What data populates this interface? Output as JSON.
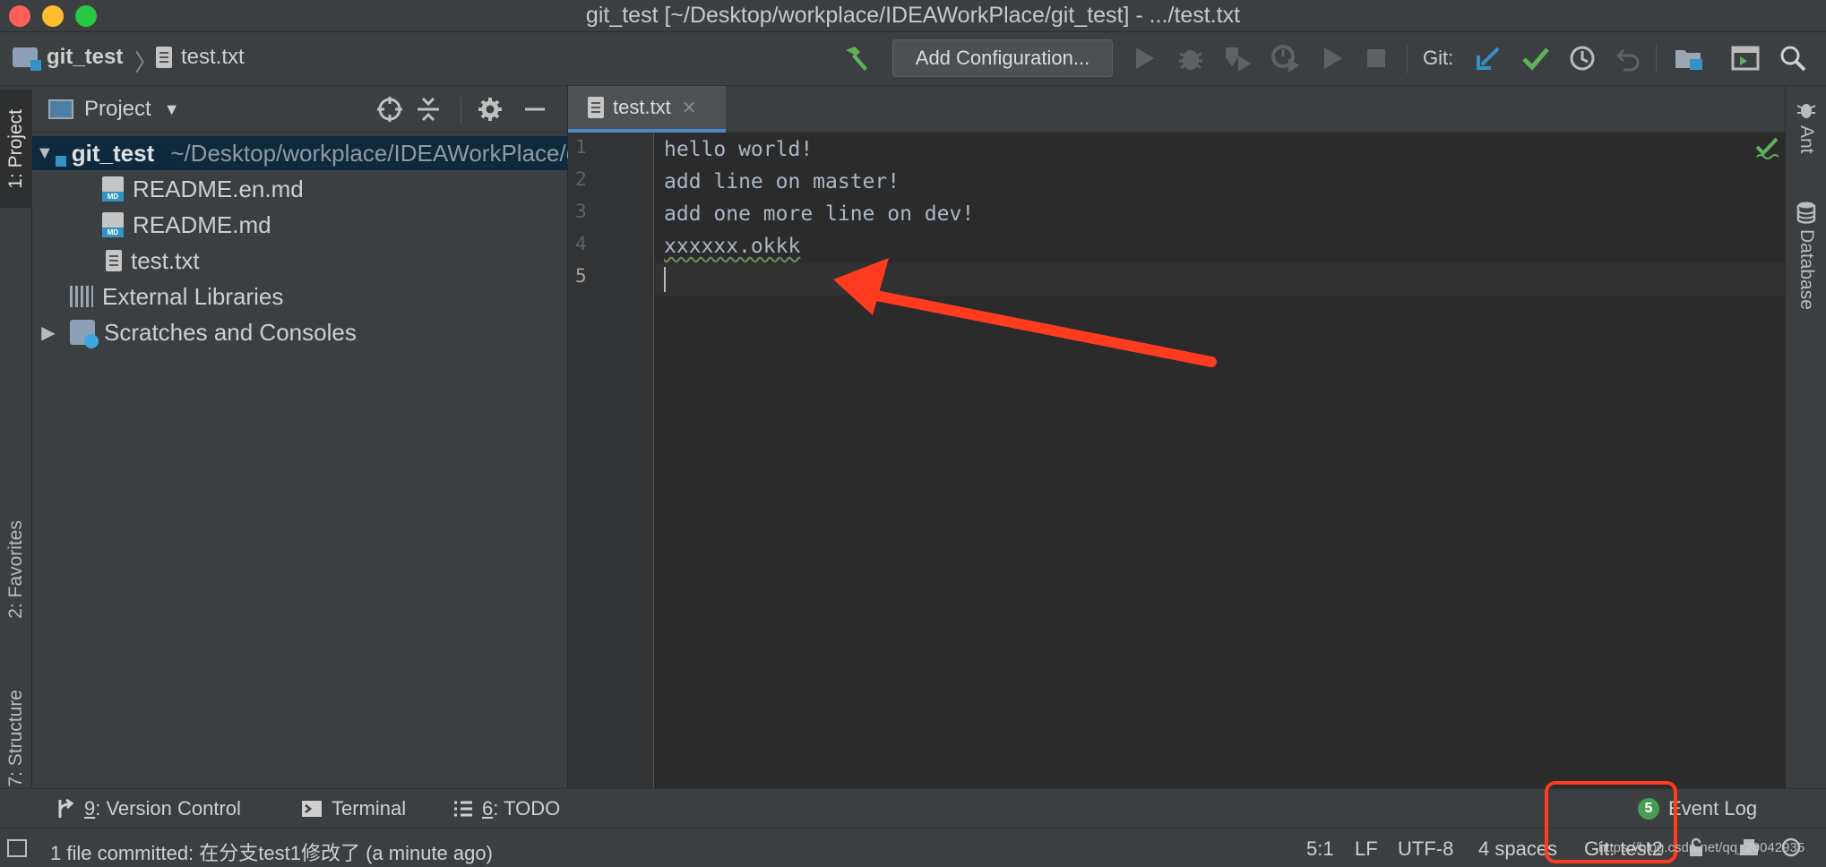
{
  "window": {
    "title": "git_test [~/Desktop/workplace/IDEAWorkPlace/git_test] - .../test.txt"
  },
  "navbar": {
    "project_crumb": "git_test",
    "file_crumb": "test.txt",
    "separator": "〉",
    "add_configuration_label": "Add Configuration...",
    "git_label": "Git:",
    "icons": [
      "hammer-icon",
      "run-icon",
      "debug-icon",
      "coverage-icon",
      "profile-icon",
      "run-anything-icon",
      "stop-icon",
      "git-update-icon",
      "git-commit-icon",
      "git-history-icon",
      "git-rollback-icon",
      "project-structure-icon",
      "terminal-run-icon",
      "search-icon"
    ]
  },
  "left_tabs": {
    "project": "1: Project",
    "favorites": "2: Favorites",
    "structure": "7: Structure"
  },
  "right_tabs": {
    "ant": "Ant",
    "database": "Database"
  },
  "project_panel": {
    "title": "Project",
    "root": {
      "name": "git_test",
      "path": "~/Desktop/workplace/IDEAWorkPlace/git_test"
    },
    "files": [
      {
        "name": "README.en.md",
        "kind": "markdown"
      },
      {
        "name": "README.md",
        "kind": "markdown"
      },
      {
        "name": "test.txt",
        "kind": "text"
      }
    ],
    "external_libraries": "External Libraries",
    "scratches": "Scratches and Consoles"
  },
  "editor": {
    "tab_label": "test.txt",
    "tab_close": "✕",
    "lines": [
      "hello world!",
      "add line on master!",
      "add one more line on dev!",
      "xxxxxx.okkk",
      ""
    ],
    "line_numbers": [
      "1",
      "2",
      "3",
      "4",
      "5"
    ],
    "current_line": 5
  },
  "tool_window_bar": {
    "version_control": {
      "num": "9",
      "label": ": Version Control"
    },
    "terminal": "Terminal",
    "todo": {
      "num": "6",
      "label": ": TODO"
    },
    "event_log_count": "5",
    "event_log": "Event Log"
  },
  "status_bar": {
    "message": "1 file committed: 在分支test1修改了 (a minute ago)",
    "position": "5:1",
    "line_separator": "LF",
    "encoding": "UTF-8",
    "indent": "4 spaces",
    "git_branch": "Git: test2"
  },
  "watermark": "https://blog.csdn.net/qq_20042935",
  "colors": {
    "annotation_red": "#ff3b1f",
    "accent_blue": "#4a88c7",
    "success_green": "#5fb15a"
  }
}
